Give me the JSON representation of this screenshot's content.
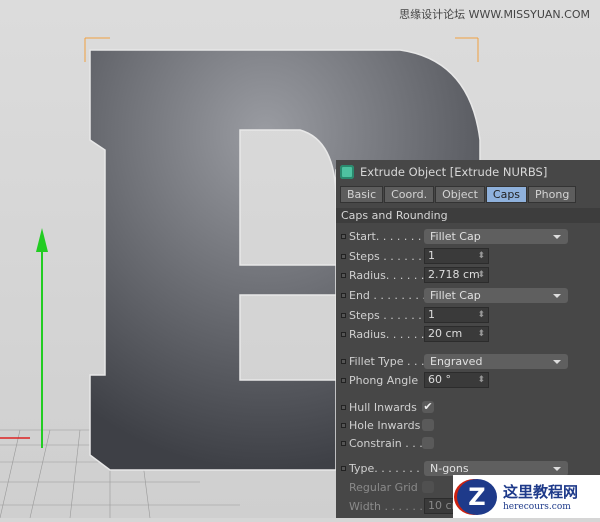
{
  "watermark_top": "思缘设计论坛 WWW.MISSYUAN.COM",
  "panel": {
    "title": "Extrude Object [Extrude NURBS]",
    "tabs": [
      {
        "label": "Basic"
      },
      {
        "label": "Coord."
      },
      {
        "label": "Object"
      },
      {
        "label": "Caps",
        "active": true
      },
      {
        "label": "Phong"
      }
    ],
    "section": "Caps and Rounding",
    "rows": {
      "start": {
        "label": "Start. . . . . . . .",
        "value": "Fillet Cap"
      },
      "steps1": {
        "label": "Steps . . . . . . .",
        "value": "1"
      },
      "radius1": {
        "label": "Radius. . . . . .",
        "value": "2.718 cm"
      },
      "end": {
        "label": "End . . . . . . . .",
        "value": "Fillet Cap"
      },
      "steps2": {
        "label": "Steps . . . . . . .",
        "value": "1"
      },
      "radius2": {
        "label": "Radius. . . . . .",
        "value": "20 cm"
      },
      "fillet_type": {
        "label": "Fillet Type . . .",
        "value": "Engraved"
      },
      "phong_angle": {
        "label": "Phong Angle",
        "value": "60 °"
      },
      "hull_inwards": {
        "label": "Hull Inwards",
        "checked": true
      },
      "hole_inwards": {
        "label": "Hole Inwards",
        "checked": false
      },
      "constrain": {
        "label": "Constrain . . .",
        "checked": false
      },
      "type": {
        "label": "Type. . . . . . . .",
        "value": "N-gons"
      },
      "regular_grid": {
        "label": "Regular Grid",
        "checked": false
      },
      "width": {
        "label": "Width . . . . . .",
        "value": "10 cm"
      }
    }
  },
  "logo": {
    "title": "这里教程网",
    "url": "herecours.com",
    "mark": "Z"
  },
  "colors": {
    "panel_bg": "#474747",
    "active_tab": "#8fb1dc",
    "axis_y": "#22cc22"
  }
}
